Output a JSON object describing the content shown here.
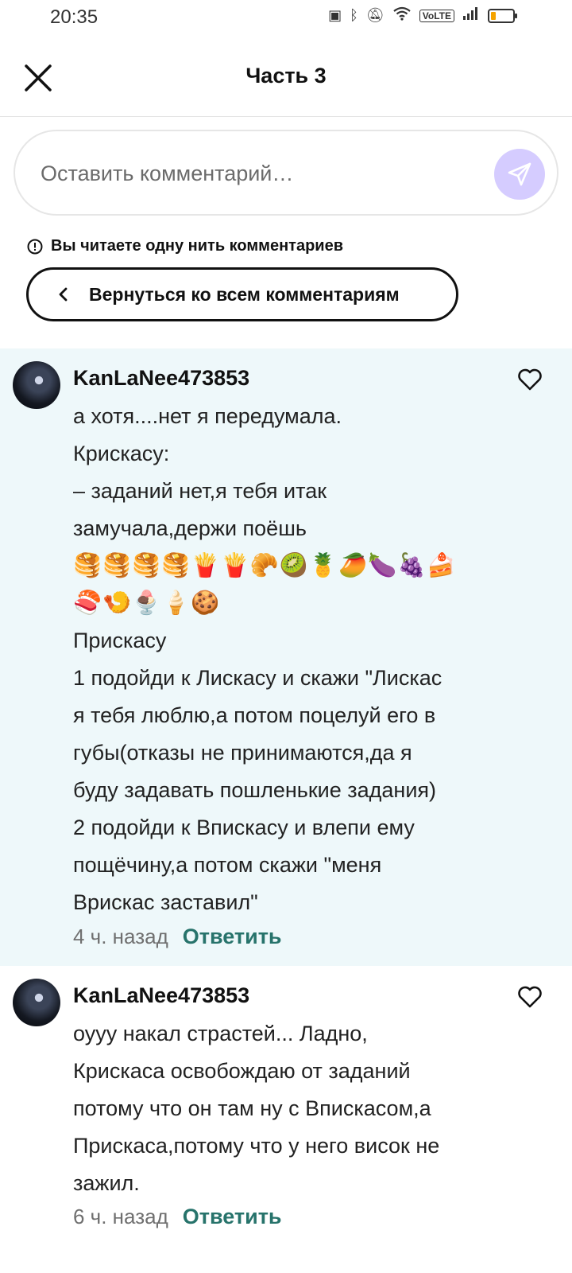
{
  "status_bar": {
    "time": "20:35",
    "volte": "VoLTE"
  },
  "header": {
    "title": "Часть 3"
  },
  "comment_input": {
    "placeholder": "Оставить комментарий…"
  },
  "thread_notice": "Вы читаете одну нить комментариев",
  "back_button": "Вернуться ко всем комментариям",
  "comments": [
    {
      "username": "KanLaNee473853",
      "lines": [
        "а хотя....нет я передумала.",
        "Крискасу:",
        "– заданий нет,я тебя итак",
        "замучала,держи поёшь"
      ],
      "emoji_lines": [
        "🥞🥞🥞🥞🍟🍟🥐🥝🍍🥭🍆🍇🍰",
        "🍣🍤🍨🍦🍪"
      ],
      "lines_after": [
        "Прискасу",
        "1 подойди к Лискасу и скажи \"Лискас",
        "я тебя люблю,а потом поцелуй его в",
        "губы(отказы не принимаются,да я",
        "буду задавать пошленькие задания)",
        "2 подойди к Впискасу и влепи ему",
        "пощёчину,а потом скажи \"меня",
        "Врискас заставил\""
      ],
      "time": "4 ч. назад",
      "reply_label": "Ответить"
    },
    {
      "username": "KanLaNee473853",
      "lines": [
        "оууу накал страстей... Ладно,",
        "Крискаса освобождаю от заданий",
        "потому что он там ну с Впискасом,а",
        "Прискаса,потому что у него висок не",
        "зажил."
      ],
      "time": "6 ч. назад",
      "reply_label": "Ответить"
    }
  ],
  "colors": {
    "highlight_bg": "#eef8fa",
    "send_button": "#d5ccff",
    "reply_link": "#27736b"
  }
}
